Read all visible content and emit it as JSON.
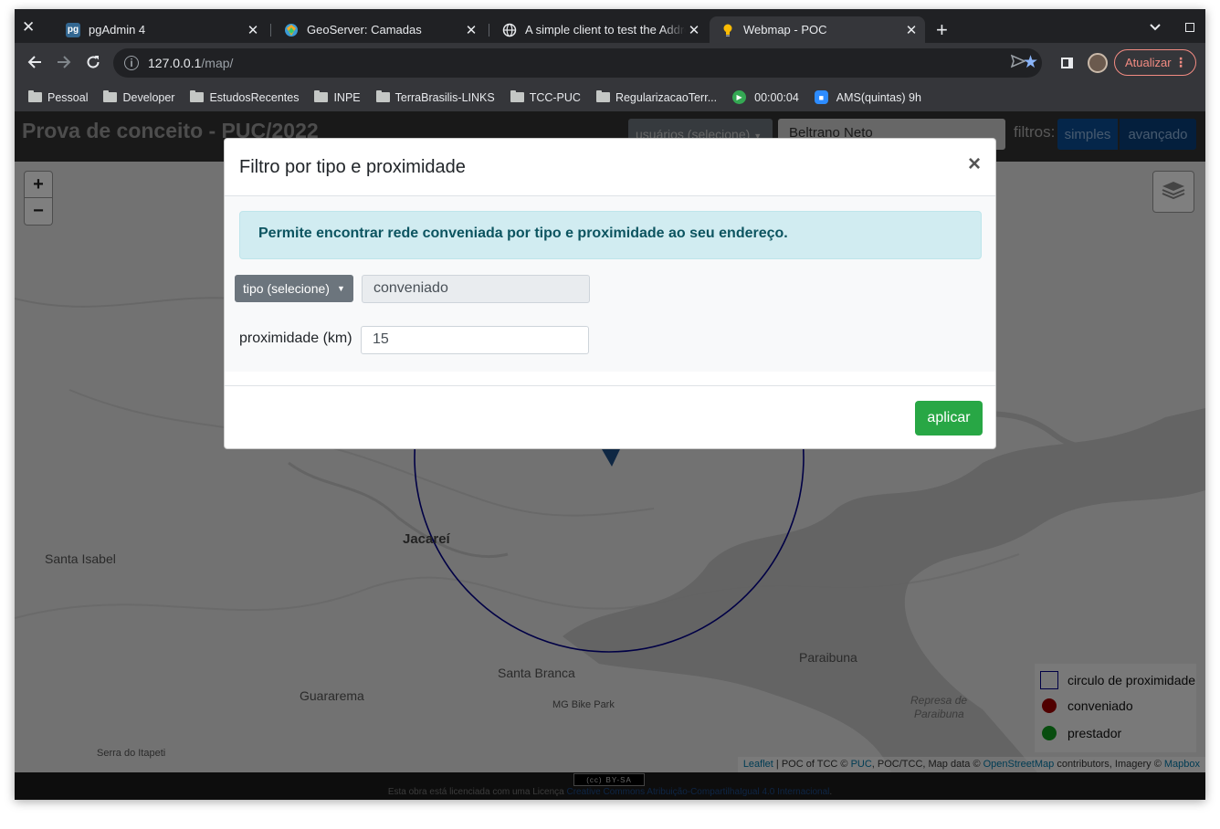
{
  "browser": {
    "tabs": [
      {
        "title": "pgAdmin 4",
        "favicon": "pg"
      },
      {
        "title": "GeoServer: Camadas",
        "favicon": ""
      },
      {
        "title": "A simple client to test the Addre",
        "favicon": ""
      },
      {
        "title": "Webmap - POC",
        "favicon": ""
      }
    ],
    "url_host": "127.0.0.1",
    "url_path": "/map/",
    "update_label": "Atualizar",
    "bookmarks": [
      {
        "label": "Pessoal",
        "icon": "folder-icon"
      },
      {
        "label": "Developer",
        "icon": "folder-icon"
      },
      {
        "label": "EstudosRecentes",
        "icon": "folder-icon"
      },
      {
        "label": "INPE",
        "icon": "folder-icon"
      },
      {
        "label": "TerraBrasilis-LINKS",
        "icon": "folder-icon"
      },
      {
        "label": "TCC-PUC",
        "icon": "folder-icon"
      },
      {
        "label": "RegularizacaoTerr...",
        "icon": "folder-icon"
      },
      {
        "label": "00:00:04",
        "icon": "play-icon"
      },
      {
        "label": "AMS(quintas) 9h",
        "icon": "zoom-icon"
      }
    ],
    "accent": "#8ab4f8"
  },
  "app": {
    "title": "Prova de conceito - PUC/2022",
    "user_dropdown": "usuários (selecione)",
    "user_value": "Beltrano Neto",
    "filters_label": "filtros:",
    "btn_simples": "simples",
    "btn_avancado": "avançado"
  },
  "map": {
    "zoom_in": "+",
    "zoom_out": "−",
    "places": [
      "Santa Isabel",
      "Jacareí",
      "Santa Branca",
      "Guararema",
      "MG Bike Park",
      "Paraibuna",
      "Represa de",
      "Paraibuna",
      "Serra do Itapeti"
    ],
    "legend": [
      {
        "label": "circulo de proximidade",
        "color": "#00008b"
      },
      {
        "label": "conveniado",
        "color": "#a00000"
      },
      {
        "label": "prestador",
        "color": "#119a1e"
      }
    ],
    "attribution": {
      "leaflet": "Leaflet",
      "text1": " | POC of TCC © ",
      "puc": "PUC",
      "text2": ", POC/TCC, Map data © ",
      "osm": "OpenStreetMap",
      "text3": " contributors, Imagery © ",
      "mapbox": "Mapbox"
    }
  },
  "footer": {
    "badge": "BY-SA",
    "license_prefix": "Esta obra está licenciada com uma Licença ",
    "license_link": "Creative Commons Atribuição-CompartilhaIgual 4.0 Internacional",
    "license_suffix": "."
  },
  "modal": {
    "title": "Filtro por tipo e proximidade",
    "close": "×",
    "alert": "Permite encontrar rede conveniada por tipo e proximidade ao seu endereço.",
    "tipo_dropdown": "tipo (selecione)",
    "tipo_value": "conveniado",
    "prox_label": "proximidade (km)",
    "prox_value": "15",
    "apply": "aplicar"
  }
}
